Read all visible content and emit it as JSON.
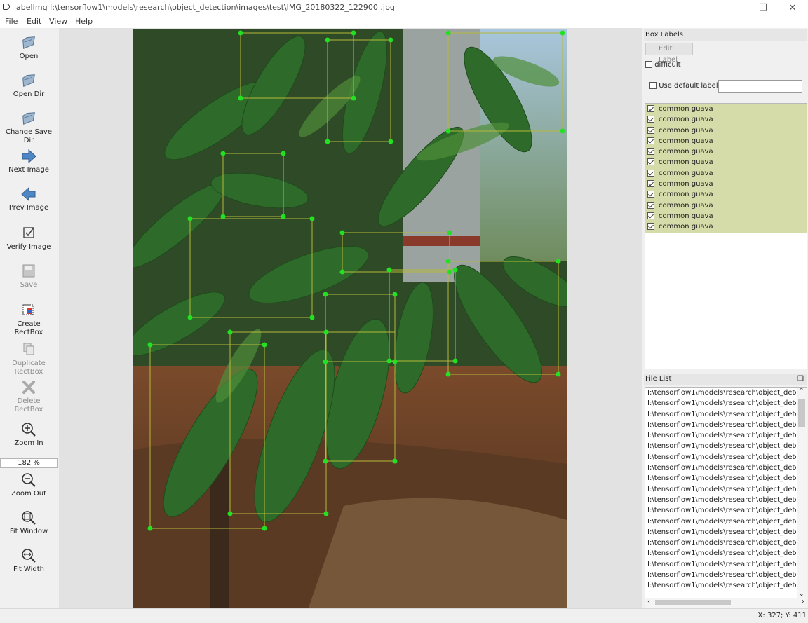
{
  "window": {
    "title": "labelImg I:\\tensorflow1\\models\\research\\object_detection\\images\\test\\IMG_20180322_122900 .jpg",
    "controls": [
      "minimize-icon",
      "restore-icon",
      "close-icon"
    ]
  },
  "menu": {
    "file": "File",
    "edit": "Edit",
    "view": "View",
    "help": "Help"
  },
  "toolbar": {
    "open": "Open",
    "open_dir": "Open Dir",
    "change_save_dir": "Change Save Dir",
    "next_image": "Next Image",
    "prev_image": "Prev Image",
    "verify_image": "Verify Image",
    "save": "Save",
    "create_rectbox_1": "Create",
    "create_rectbox_2": "RectBox",
    "duplicate_rectbox_1": "Duplicate",
    "duplicate_rectbox_2": "RectBox",
    "delete_rectbox_1": "Delete",
    "delete_rectbox_2": "RectBox",
    "zoom_in": "Zoom In",
    "zoom_value": "182 %",
    "zoom_out": "Zoom Out",
    "fit_window": "Fit Window",
    "fit_width": "Fit Width"
  },
  "box_labels": {
    "header": "Box Labels",
    "edit_label_button": "Edit Label",
    "difficult": "difficult",
    "use_default_label": "Use default label",
    "default_label_value": "",
    "labels": [
      "common guava",
      "common guava",
      "common guava",
      "common guava",
      "common guava",
      "common guava",
      "common guava",
      "common guava",
      "common guava",
      "common guava",
      "common guava",
      "common guava"
    ]
  },
  "file_list": {
    "header": "File List",
    "files": [
      "I:\\tensorflow1\\models\\research\\object_detec",
      "I:\\tensorflow1\\models\\research\\object_detec",
      "I:\\tensorflow1\\models\\research\\object_detec",
      "I:\\tensorflow1\\models\\research\\object_detec",
      "I:\\tensorflow1\\models\\research\\object_detec",
      "I:\\tensorflow1\\models\\research\\object_detec",
      "I:\\tensorflow1\\models\\research\\object_detec",
      "I:\\tensorflow1\\models\\research\\object_detec",
      "I:\\tensorflow1\\models\\research\\object_detec",
      "I:\\tensorflow1\\models\\research\\object_detec",
      "I:\\tensorflow1\\models\\research\\object_detec",
      "I:\\tensorflow1\\models\\research\\object_detec",
      "I:\\tensorflow1\\models\\research\\object_detec",
      "I:\\tensorflow1\\models\\research\\object_detec",
      "I:\\tensorflow1\\models\\research\\object_detec",
      "I:\\tensorflow1\\models\\research\\object_detec",
      "I:\\tensorflow1\\models\\research\\object_detec",
      "I:\\tensorflow1\\models\\research\\object_detec",
      "I:\\tensorflow1\\models\\research\\object_detec"
    ]
  },
  "status": {
    "coords": "X: 327; Y: 411"
  },
  "colors": {
    "box_line": "#b5b83a",
    "box_handle": "#22e022",
    "label_row_bg": "#d5dba9"
  }
}
